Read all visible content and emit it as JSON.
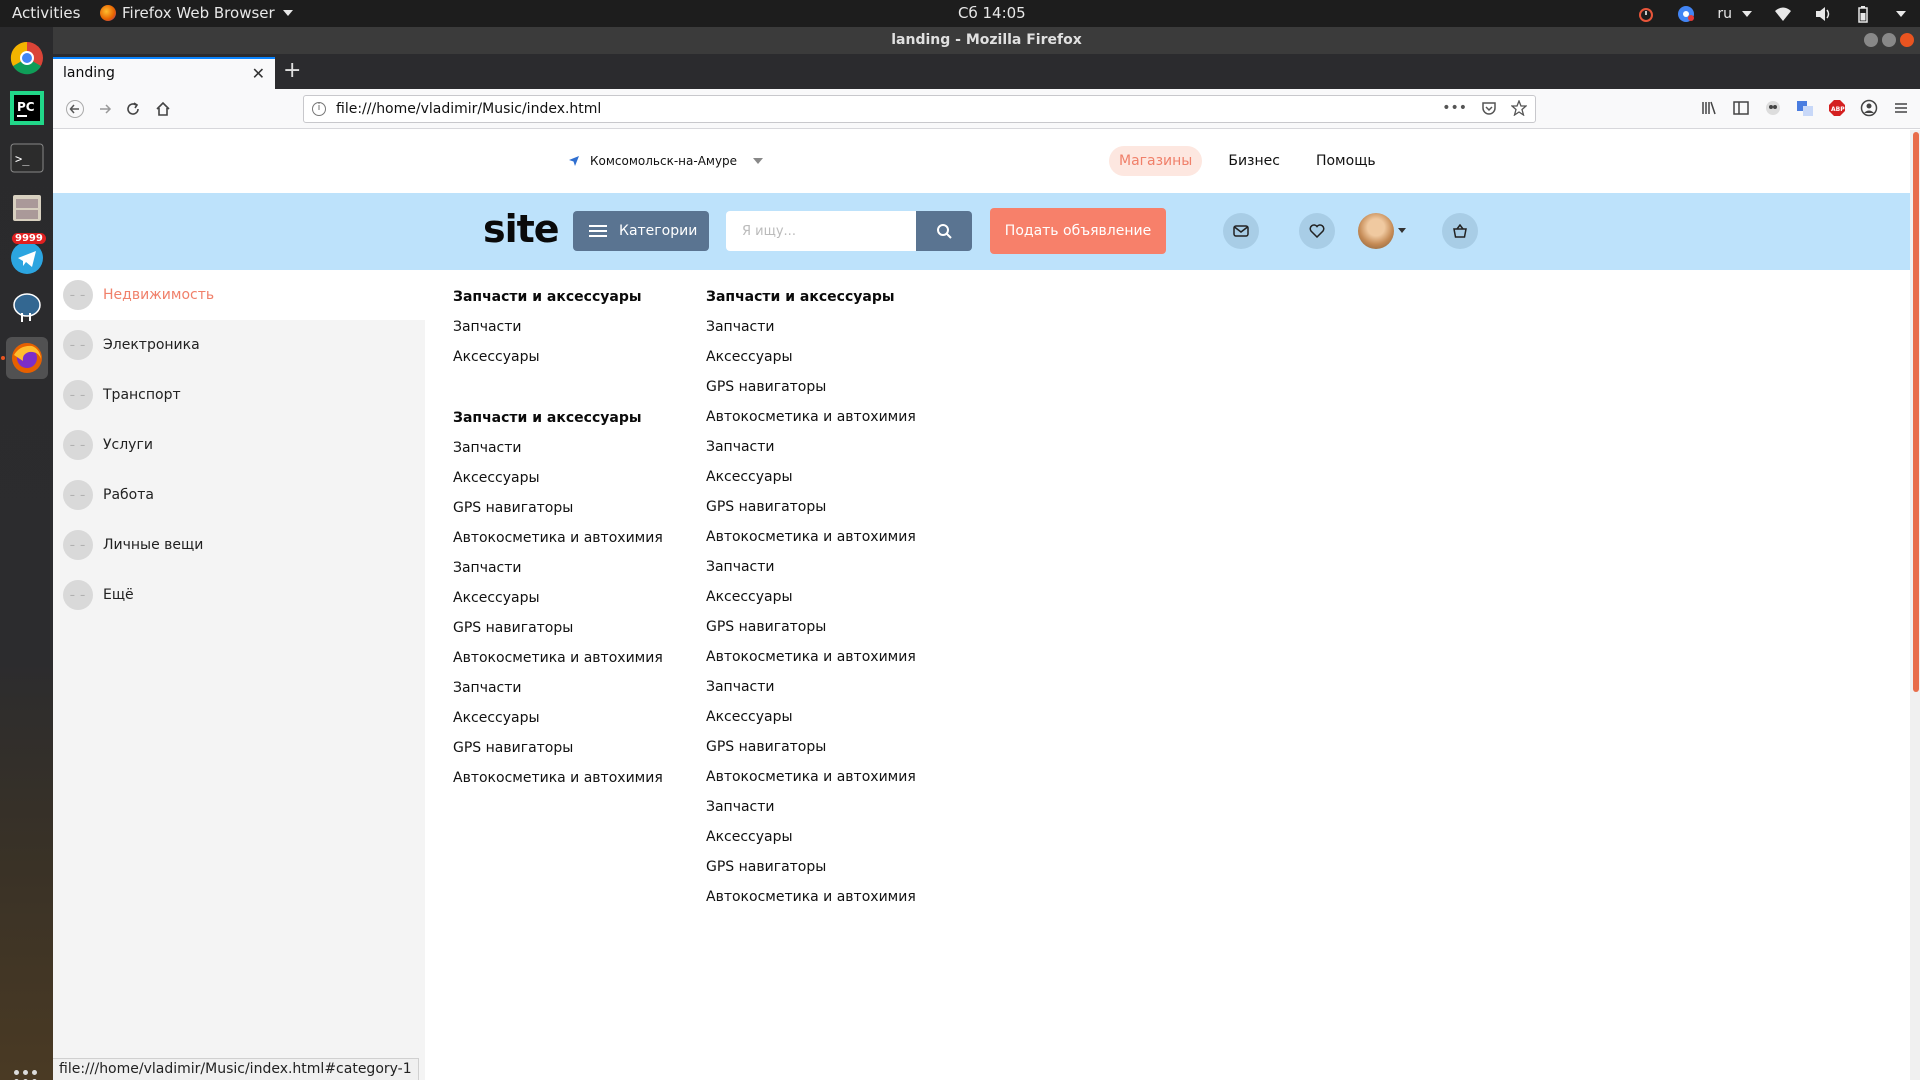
{
  "system": {
    "activities": "Activities",
    "app_menu": "Firefox Web Browser",
    "clock": "Сб 14:05",
    "lang": "ru"
  },
  "dock": {
    "telegram_badge": "9999"
  },
  "window": {
    "title": "landing - Mozilla Firefox",
    "tab_title": "landing",
    "url": "file:///home/vladimir/Music/index.html",
    "status_url": "file:///home/vladimir/Music/index.html#category-1"
  },
  "site": {
    "city": "Комсомольск-на-Амуре",
    "topnav": [
      "Магазины",
      "Бизнес",
      "Помощь"
    ],
    "logo": "site",
    "categories_button": "Категории",
    "search_placeholder": "Я ищу...",
    "post_button": "Подать объявление",
    "accent": "#f7806a",
    "header_bg": "#bde2fb",
    "button_blue": "#5a7491"
  },
  "sidebar": {
    "items": [
      {
        "label": "Недвижимость",
        "active": true
      },
      {
        "label": "Электроника"
      },
      {
        "label": "Транспорт"
      },
      {
        "label": "Услуги"
      },
      {
        "label": "Работа"
      },
      {
        "label": "Личные вещи"
      },
      {
        "label": "Ещё"
      }
    ]
  },
  "menu": {
    "col1": {
      "group1": {
        "heading": "Запчасти и аксессуары",
        "links": [
          "Запчасти",
          "Аксессуары"
        ]
      },
      "group2": {
        "heading": "Запчасти и аксессуары",
        "links": [
          "Запчасти",
          "Аксессуары",
          "GPS навигаторы",
          "Автокосметика и автохимия",
          "Запчасти",
          "Аксессуары",
          "GPS навигаторы",
          "Автокосметика и автохимия",
          "Запчасти",
          "Аксессуары",
          "GPS навигаторы",
          "Автокосметика и автохимия"
        ]
      }
    },
    "col2": {
      "heading": "Запчасти и аксессуары",
      "links": [
        "Запчасти",
        "Аксессуары",
        "GPS навигаторы",
        "Автокосметика и автохимия",
        "Запчасти",
        "Аксессуары",
        "GPS навигаторы",
        "Автокосметика и автохимия",
        "Запчасти",
        "Аксессуары",
        "GPS навигаторы",
        "Автокосметика и автохимия",
        "Запчасти",
        "Аксессуары",
        "GPS навигаторы",
        "Автокосметика и автохимия",
        "Запчасти",
        "Аксессуары",
        "GPS навигаторы",
        "Автокосметика и автохимия"
      ]
    }
  }
}
